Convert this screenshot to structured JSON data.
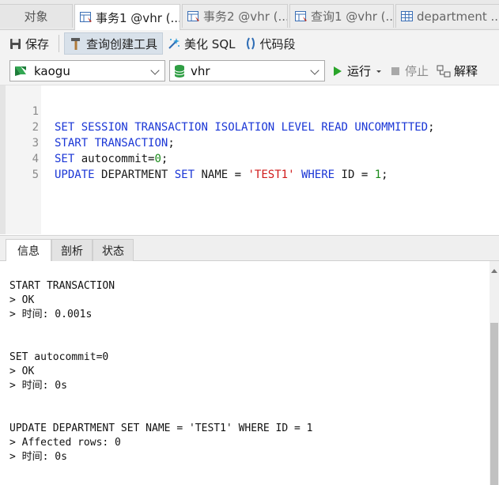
{
  "tabs": [
    {
      "label": "对象"
    },
    {
      "label": "事务1 @vhr (..."
    },
    {
      "label": "事务2 @vhr (..."
    },
    {
      "label": "查询1 @vhr (..."
    },
    {
      "label": "department ..."
    }
  ],
  "toolbar": {
    "save_label": "保存",
    "query_builder_label": "查询创建工具",
    "beautify_label": "美化 SQL",
    "snippet_label": "代码段"
  },
  "selectors": {
    "connection": "kaogu",
    "database": "vhr"
  },
  "run": {
    "run_label": "运行",
    "stop_label": "停止",
    "explain_label": "解释"
  },
  "editor": {
    "line_numbers": [
      "1",
      "2",
      "3",
      "4",
      "5"
    ],
    "lines": [
      "SET SESSION TRANSACTION ISOLATION LEVEL READ UNCOMMITTED;",
      "START TRANSACTION;",
      "SET autocommit=0;",
      "UPDATE DEPARTMENT SET NAME = 'TEST1' WHERE ID = 1;",
      ""
    ]
  },
  "bottom_tabs": [
    "信息",
    "剖析",
    "状态"
  ],
  "output": [
    "START TRANSACTION",
    "> OK",
    "> 时间: 0.001s",
    "SET autocommit=0",
    "> OK",
    "> 时间: 0s",
    "UPDATE DEPARTMENT SET NAME = 'TEST1' WHERE ID = 1",
    "> Affected rows: 0",
    "> 时间: 0s"
  ],
  "colors": {
    "keyword": "#1a36d6",
    "string": "#d11b1b",
    "number": "#1a8a1a",
    "run_green": "#2aa52a"
  }
}
